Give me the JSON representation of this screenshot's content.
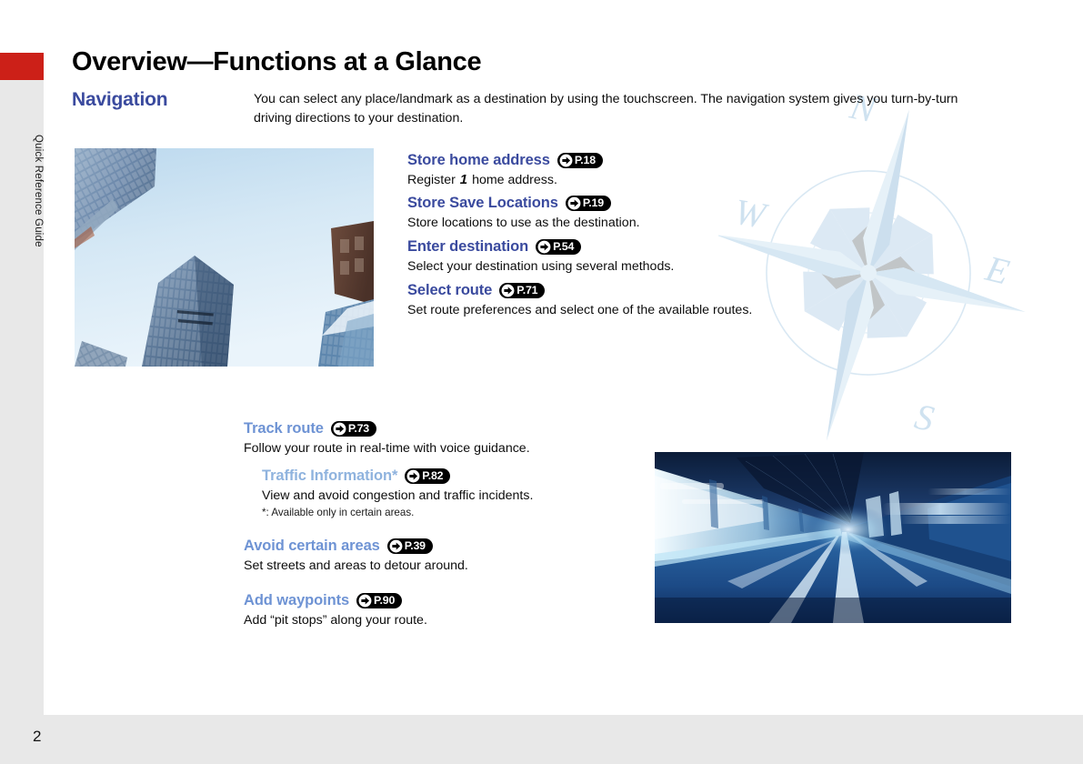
{
  "sidebar": {
    "tab_label": "Quick Reference Guide",
    "tab_color": "#cc2018",
    "strip_color": "#e8e8e8"
  },
  "footer": {
    "page_number": "2"
  },
  "header": {
    "title": "Overview—Functions at a Glance",
    "section": "Navigation",
    "intro": "You can select any place/landmark as a destination by using the touchscreen. The navigation system gives you turn-by-turn driving directions to your destination."
  },
  "colors": {
    "heading_blue": "#3a4a9e",
    "subheading_blue": "#6e93d4",
    "light_blue": "#8fb3de",
    "badge_bg": "#000000",
    "tab_red": "#cc2018",
    "compass_blue": "#d4e4f0"
  },
  "compass": {
    "labels": [
      "N",
      "W",
      "E",
      "S"
    ]
  },
  "photos": [
    {
      "name": "city-skyscrapers",
      "alt": "Looking up at glass skyscrapers against a pale blue sky"
    },
    {
      "name": "tunnel-motion-blur",
      "alt": "Motion-blurred view driving through a blue-lit tunnel"
    }
  ],
  "features_upper": [
    {
      "title": "Store home address",
      "page_ref": "P.18",
      "desc_before": "Register ",
      "desc_number": "1",
      "desc_after": " home address.",
      "style": "head-dark"
    },
    {
      "title": "Store Save Locations",
      "page_ref": "P.19",
      "desc": "Store locations to use as the destination.",
      "style": "head-dark"
    },
    {
      "title": "Enter destination",
      "page_ref": "P.54",
      "desc": "Select your destination using several methods.",
      "style": "head-dark"
    },
    {
      "title": "Select route",
      "page_ref": "P.71",
      "desc": "Set route preferences and select one of the available routes.",
      "style": "head-dark"
    }
  ],
  "features_lower": [
    {
      "title": "Track route",
      "page_ref": "P.73",
      "desc": "Follow your route in real-time with voice guidance.",
      "style": "head-mid"
    },
    {
      "title": "Traffic Information*",
      "page_ref": "P.82",
      "desc": "View and avoid congestion and traffic incidents.",
      "note": "*: Available only in certain areas.",
      "style": "head-light"
    },
    {
      "title": "Avoid certain areas",
      "page_ref": "P.39",
      "desc": "Set streets and areas to detour around.",
      "style": "head-mid"
    },
    {
      "title": "Add waypoints",
      "page_ref": "P.90",
      "desc": "Add “pit stops” along your route.",
      "style": "head-mid"
    }
  ]
}
